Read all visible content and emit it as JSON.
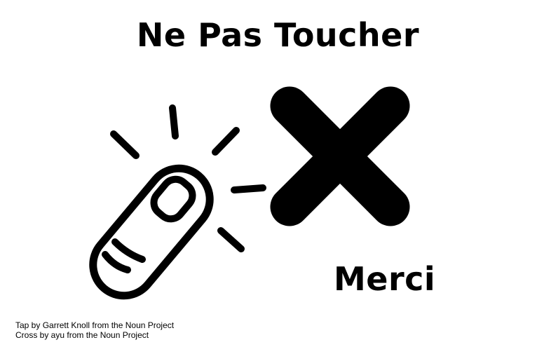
{
  "sign": {
    "title": "Ne Pas Toucher",
    "thanks": "Merci",
    "credits": {
      "line1": "Tap by Garrett Knoll from the Noun Project",
      "line2": "Cross by ayu from the Noun Project"
    }
  },
  "icons": {
    "tap": "finger-tap-icon",
    "cross": "cross-icon"
  },
  "colors": {
    "foreground": "#000000",
    "background": "#ffffff"
  }
}
